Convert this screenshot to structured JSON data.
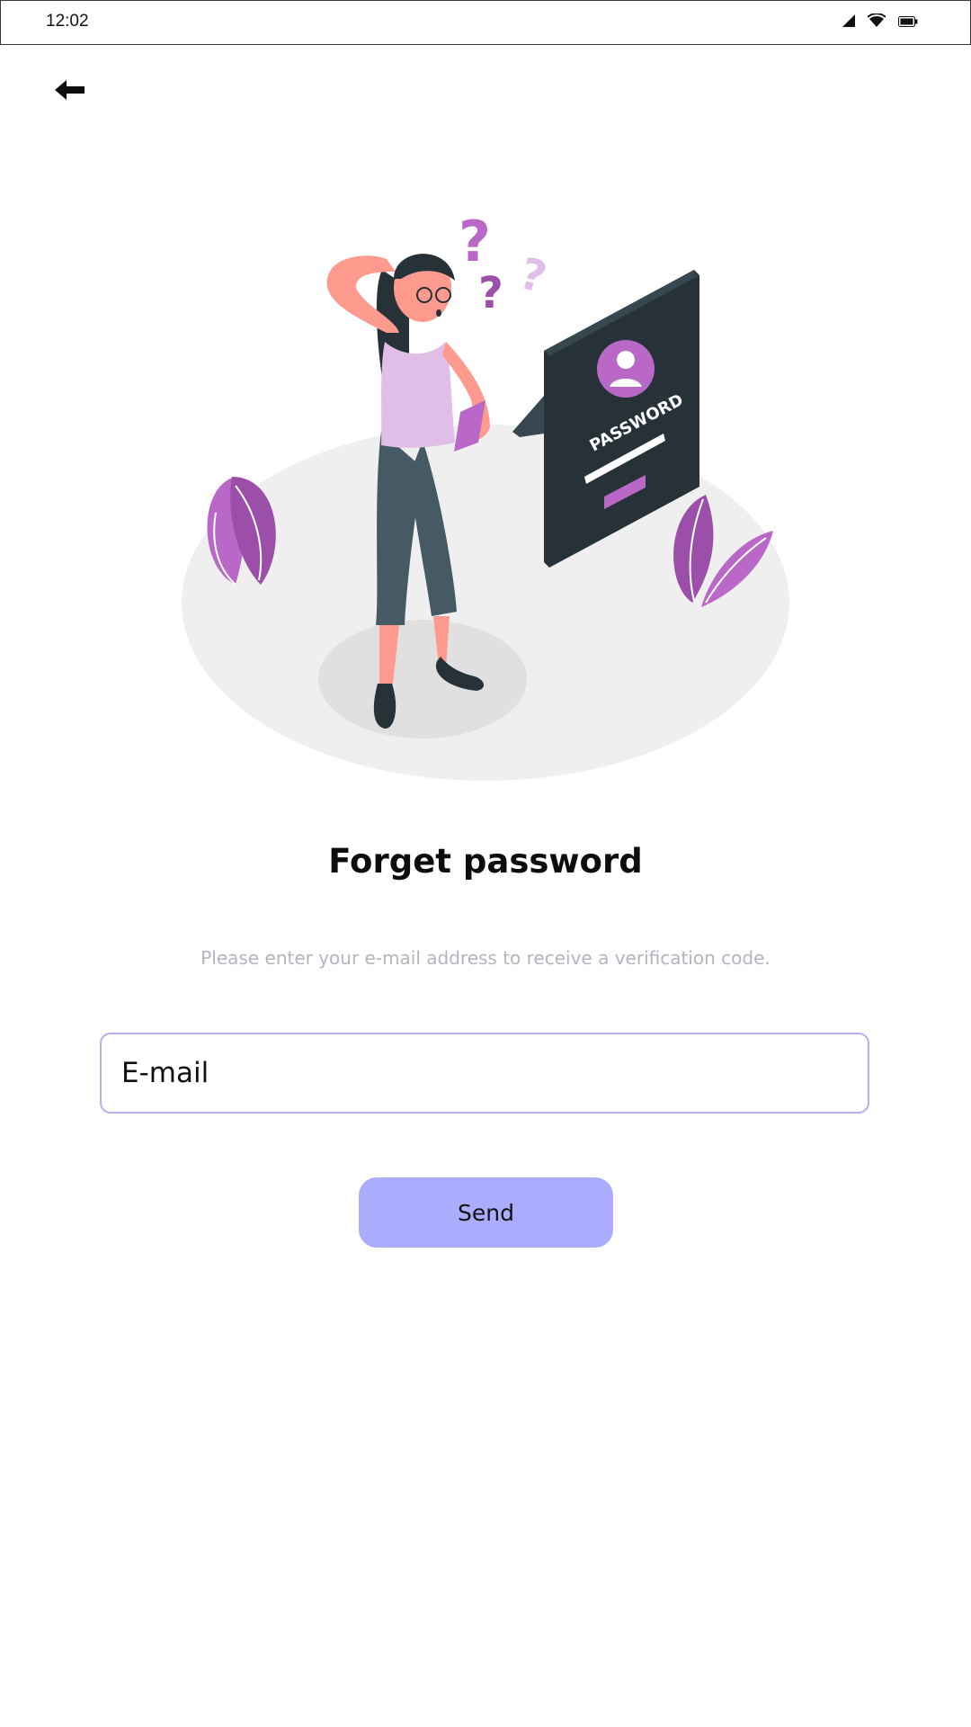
{
  "status_bar": {
    "time": "12:02",
    "icons": [
      "signal-icon",
      "wifi-icon",
      "battery-icon"
    ]
  },
  "nav": {
    "back_icon": "arrow-left-icon"
  },
  "illustration": {
    "panel_text": "PASSWORD",
    "colors": {
      "accent": "#b968c7",
      "panel": "#37474f",
      "floor": "#efefef"
    }
  },
  "content": {
    "title": "Forget password",
    "subtitle": "Please enter your e-mail address to receive a verification code."
  },
  "form": {
    "email_placeholder": "E-mail",
    "email_value": "",
    "send_label": "Send",
    "colors": {
      "button": "#abacfd",
      "field_border": "#b3aff2"
    }
  }
}
